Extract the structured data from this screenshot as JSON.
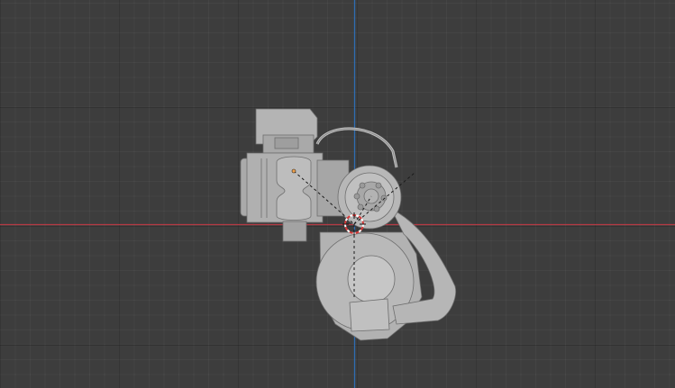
{
  "viewport": {
    "grid_visible": true,
    "x_axis_color": "#b53a44",
    "y_axis_color": "#2f6db3",
    "background_color": "#3d3d3d",
    "model_color": "#b8b8b8"
  },
  "icons": {
    "origin": "object-origin-icon",
    "cursor": "3d-cursor-icon"
  }
}
